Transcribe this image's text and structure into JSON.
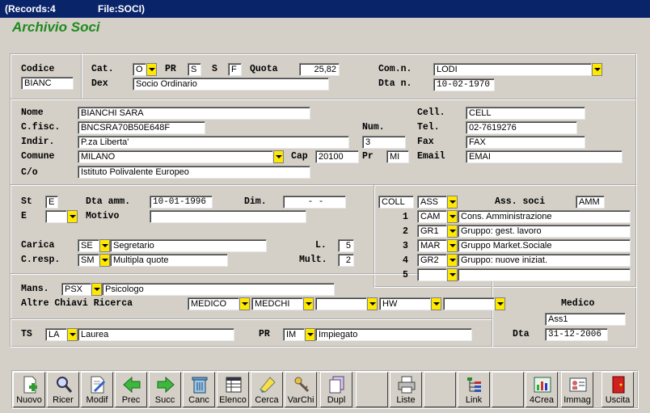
{
  "titlebar": {
    "records": "(Records:4",
    "file": "File:SOCI)"
  },
  "app_title": "Archivio Soci",
  "top": {
    "codice_label": "Codice",
    "codice": "BIANC",
    "cat_label": "Cat.",
    "cat": "O",
    "pr_label": "PR",
    "pr": "S",
    "s_label": "S",
    "s": "F",
    "quota_label": "Quota",
    "quota": "25,82",
    "dex_label": "Dex",
    "dex": "Socio Ordinario",
    "comn_label": "Com.n.",
    "comn": "LODI",
    "dtan_label": "Dta n.",
    "dtan": "10-02-1970"
  },
  "anag": {
    "nome_label": "Nome",
    "nome": "BIANCHI SARA",
    "cfisc_label": "C.fisc.",
    "cfisc": "BNCSRA70B50E648F",
    "indir_label": "Indir.",
    "indir": "P.za Liberta'",
    "num_label": "Num.",
    "num": "3",
    "comune_label": "Comune",
    "comune": "MILANO",
    "cap_label": "Cap",
    "cap": "20100",
    "pr_label": "Pr",
    "pr": "MI",
    "co_label": "C/o",
    "co": "Istituto Polivalente Europeo",
    "cell_label": "Cell.",
    "cell": "CELL",
    "tel_label": "Tel.",
    "tel": "02-7619276",
    "fax_label": "Fax",
    "fax": "FAX",
    "email_label": "Email",
    "email": "EMAI"
  },
  "status": {
    "st_label": "St",
    "st": "E",
    "dtaamm_label": "Dta amm.",
    "dtaamm": "10-01-1996",
    "dim_label": "Dim.",
    "dim": "-   -",
    "e_label": "E",
    "e": "",
    "motivo_label": "Motivo",
    "motivo": "",
    "carica_label": "Carica",
    "carica_code": "SE",
    "carica": "Segretario",
    "l_label": "L.",
    "l": "5",
    "cresp_label": "C.resp.",
    "cresp_code": "SM",
    "cresp": "Multipla quote",
    "mult_label": "Mult.",
    "mult": "2"
  },
  "assoc": {
    "coll": "COLL",
    "ass": "ASS",
    "label": "Ass. soci",
    "amm": "AMM",
    "rows": [
      {
        "n": "1",
        "code": "CAM",
        "desc": "Cons. Amministrazione"
      },
      {
        "n": "2",
        "code": "GR1",
        "desc": "Gruppo: gest. lavoro"
      },
      {
        "n": "3",
        "code": "MAR",
        "desc": "Gruppo Market.Sociale"
      },
      {
        "n": "4",
        "code": "GR2",
        "desc": "Gruppo: nuove iniziat."
      },
      {
        "n": "5",
        "code": "",
        "desc": ""
      }
    ]
  },
  "mans": {
    "label": "Mans.",
    "code": "PSX",
    "desc": "Psicologo"
  },
  "chiavi": {
    "label": "Altre Chiavi Ricerca",
    "k1": "MEDICO",
    "k2": "MEDCHI",
    "k3": "",
    "k4": "HW",
    "k5": ""
  },
  "ts": {
    "label": "TS",
    "code": "LA",
    "desc": "Laurea",
    "pr_label": "PR",
    "pr_code": "IM",
    "pr_desc": "Impiegato"
  },
  "medico": {
    "label": "Medico",
    "value": "Ass1",
    "dta_label": "Dta",
    "dta": "31-12-2006"
  },
  "toolbar": {
    "nuovo": "Nuovo",
    "ricer": "Ricer",
    "modif": "Modif",
    "prec": "Prec",
    "succ": "Succ",
    "canc": "Canc",
    "elenco": "Elenco",
    "cerca": "Cerca",
    "varchi": "VarChi",
    "dupl": "Dupl",
    "liste": "Liste",
    "link": "Link",
    "crea": "4Crea",
    "immag": "Immag",
    "uscita": "Uscita"
  },
  "colors": {
    "titlebar": "#0a246a",
    "app_title": "#1e8a1e",
    "dropdown": "#ffe800",
    "window": "#d4d0c8"
  }
}
